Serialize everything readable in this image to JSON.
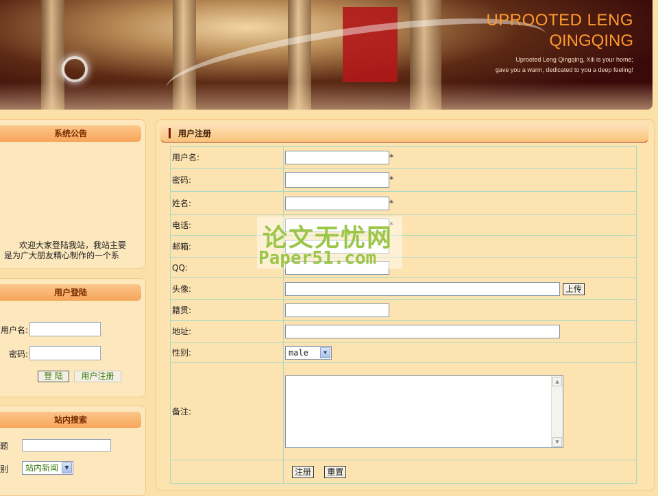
{
  "banner": {
    "title_line1": "UPROOTED LENG",
    "title_line2": "QINGQING",
    "tagline1": "Uprooted Leng Qingqing, Xili is your home;",
    "tagline2": "gave you a warm, dedicated to you a deep feeling!"
  },
  "sidebar": {
    "notice": {
      "title": "系统公告",
      "text_line1": "欢迎大家登陆我站，我站主要",
      "text_line2": "是为广大朋友精心制作的一个系"
    },
    "login": {
      "title": "用户登陆",
      "username_label": "用户名:",
      "password_label": "密码:",
      "login_button": "登 陆",
      "register_button": "用户注册"
    },
    "search": {
      "title": "站内搜索",
      "title_label": "标题",
      "category_label": "类别",
      "category_value": "站内新闻"
    }
  },
  "main": {
    "heading": "用户注册",
    "fields": {
      "username": "用户名:",
      "password": "密码:",
      "name": "姓名:",
      "phone": "电话:",
      "email": "邮箱:",
      "qq": "QQ:",
      "avatar": "头像:",
      "hometown": "籍贯:",
      "address": "地址:",
      "gender": "性别:",
      "remark": "备注:"
    },
    "required_mark": "*",
    "upload_button": "上传",
    "gender_value": "male",
    "submit_button": "注册",
    "reset_button": "重置"
  },
  "watermark": {
    "line1": "论文无忧网",
    "line2": "Paper51.com"
  }
}
